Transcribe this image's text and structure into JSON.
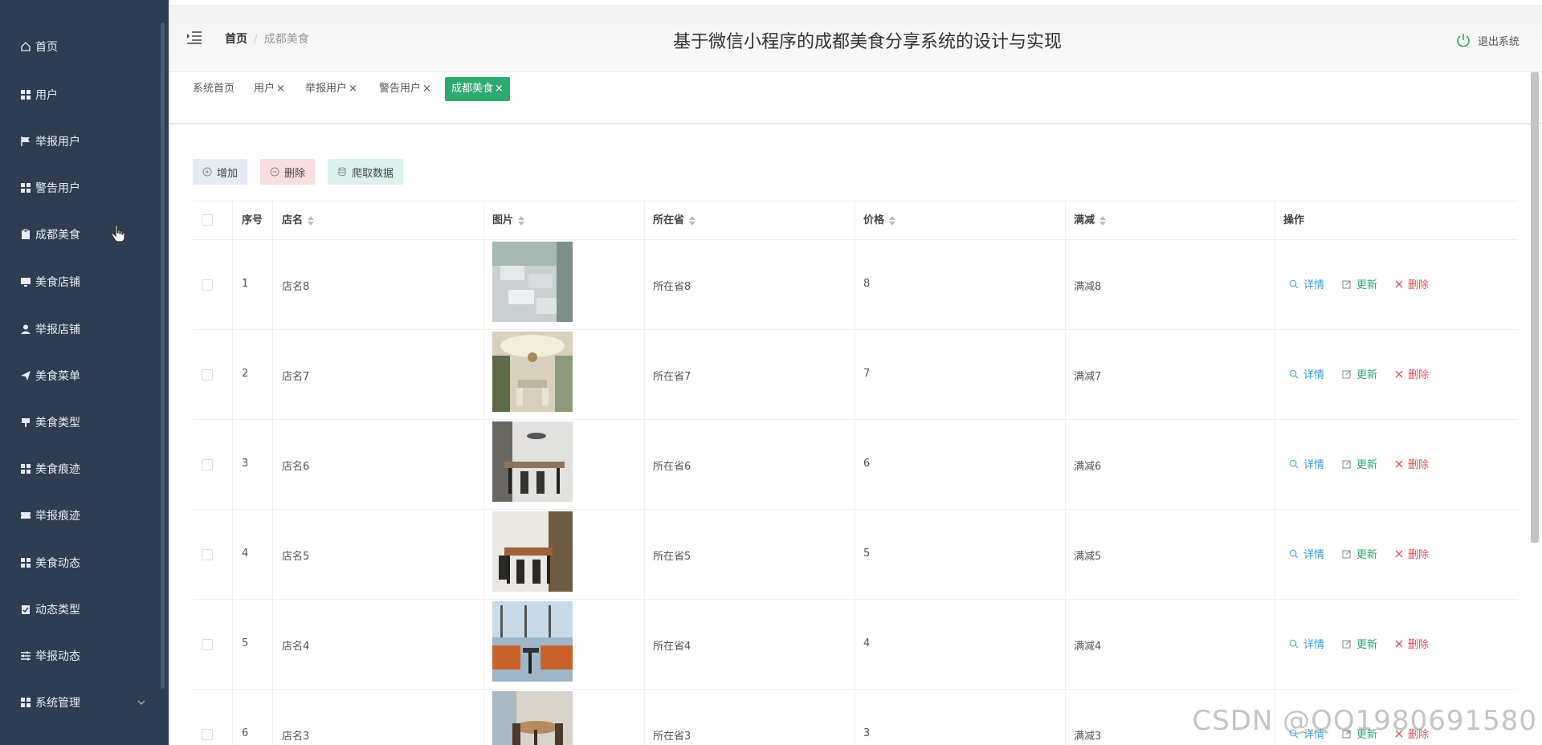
{
  "sidebar": {
    "items": [
      {
        "label": "首页",
        "icon": "home-icon"
      },
      {
        "label": "用户",
        "icon": "grid-icon"
      },
      {
        "label": "举报用户",
        "icon": "flag-icon"
      },
      {
        "label": "警告用户",
        "icon": "grid-icon"
      },
      {
        "label": "成都美食",
        "icon": "clipboard-icon"
      },
      {
        "label": "美食店铺",
        "icon": "monitor-icon"
      },
      {
        "label": "举报店铺",
        "icon": "user-icon"
      },
      {
        "label": "美食菜单",
        "icon": "send-icon"
      },
      {
        "label": "美食类型",
        "icon": "sign-icon"
      },
      {
        "label": "美食痕迹",
        "icon": "grid-icon"
      },
      {
        "label": "举报痕迹",
        "icon": "ticket-icon"
      },
      {
        "label": "美食动态",
        "icon": "grid-icon"
      },
      {
        "label": "动态类型",
        "icon": "clipboard-icon"
      },
      {
        "label": "举报动态",
        "icon": "sliders-icon"
      },
      {
        "label": "系统管理",
        "icon": "grid-icon"
      }
    ]
  },
  "header": {
    "breadcrumb_home": "首页",
    "breadcrumb_sep": "/",
    "breadcrumb_current": "成都美食",
    "title": "基于微信小程序的成都美食分享系统的设计与实现",
    "logout_label": "退出系统"
  },
  "tags": [
    {
      "label": "系统首页",
      "closable": false
    },
    {
      "label": "用户",
      "closable": true
    },
    {
      "label": "举报用户",
      "closable": true
    },
    {
      "label": "警告用户",
      "closable": true
    },
    {
      "label": "成都美食",
      "closable": true,
      "active": true
    }
  ],
  "tag_close": "×",
  "actions": {
    "add": "增加",
    "delete": "删除",
    "crawl": "爬取数据"
  },
  "table": {
    "columns": [
      "序号",
      "店名",
      "图片",
      "所在省",
      "价格",
      "满减",
      "操作"
    ],
    "op_labels": {
      "detail": "详情",
      "update": "更新",
      "delete": "删除"
    },
    "rows": [
      {
        "index": "1",
        "name": "店名8",
        "province": "所在省8",
        "price": "8",
        "discount": "满减8"
      },
      {
        "index": "2",
        "name": "店名7",
        "province": "所在省7",
        "price": "7",
        "discount": "满减7"
      },
      {
        "index": "3",
        "name": "店名6",
        "province": "所在省6",
        "price": "6",
        "discount": "满减6"
      },
      {
        "index": "4",
        "name": "店名5",
        "province": "所在省5",
        "price": "5",
        "discount": "满减5"
      },
      {
        "index": "5",
        "name": "店名4",
        "province": "所在省4",
        "price": "4",
        "discount": "满减4"
      },
      {
        "index": "6",
        "name": "店名3",
        "province": "所在省3",
        "price": "3",
        "discount": "满减3"
      }
    ]
  },
  "watermark": "CSDN @QQ1980691580",
  "colors": {
    "sidebar_bg": "#2f3d52",
    "accent_green": "#2fa970",
    "detail_blue": "#3a9bd9",
    "delete_red": "#d9534f"
  }
}
